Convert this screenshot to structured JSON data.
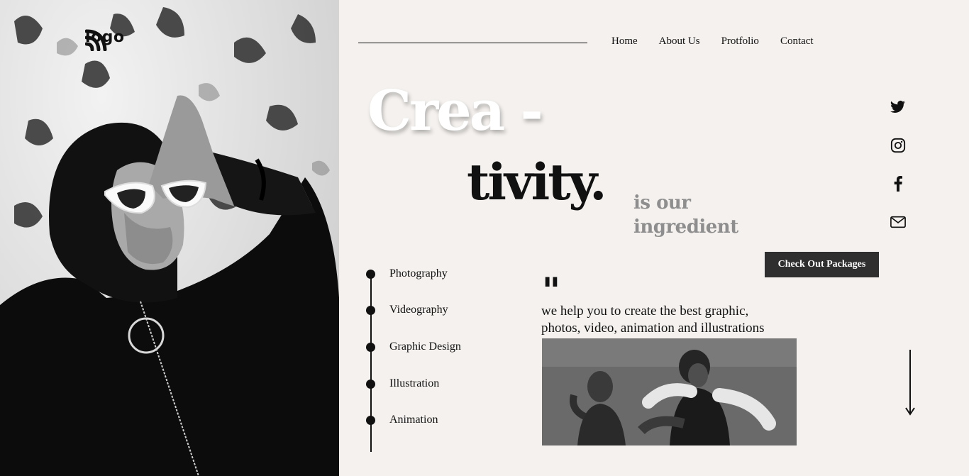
{
  "brand": {
    "logo_text": "logo"
  },
  "nav": {
    "items": [
      {
        "label": "Home"
      },
      {
        "label": "About Us"
      },
      {
        "label": "Protfolio"
      },
      {
        "label": "Contact"
      }
    ]
  },
  "hero": {
    "headline_part1": "Crea -",
    "headline_part2": "tivity.",
    "tagline_line1": "is our",
    "tagline_line2": "ingredient",
    "cta_label": "Check Out Packages"
  },
  "services": {
    "items": [
      {
        "label": "Photography"
      },
      {
        "label": "Videography"
      },
      {
        "label": "Graphic Design"
      },
      {
        "label": "Illustration"
      },
      {
        "label": "Animation"
      }
    ]
  },
  "quote": {
    "mark": "\"",
    "line1": "we help you to create the best graphic,",
    "line2": "photos, video, animation and illustrations"
  },
  "social": {
    "icons": [
      "twitter-icon",
      "instagram-icon",
      "facebook-icon",
      "mail-icon"
    ]
  },
  "colors": {
    "background": "#f4f1ee",
    "text": "#111111",
    "tagline": "#8e8e8e",
    "cta_bg": "#2f2f2f"
  }
}
